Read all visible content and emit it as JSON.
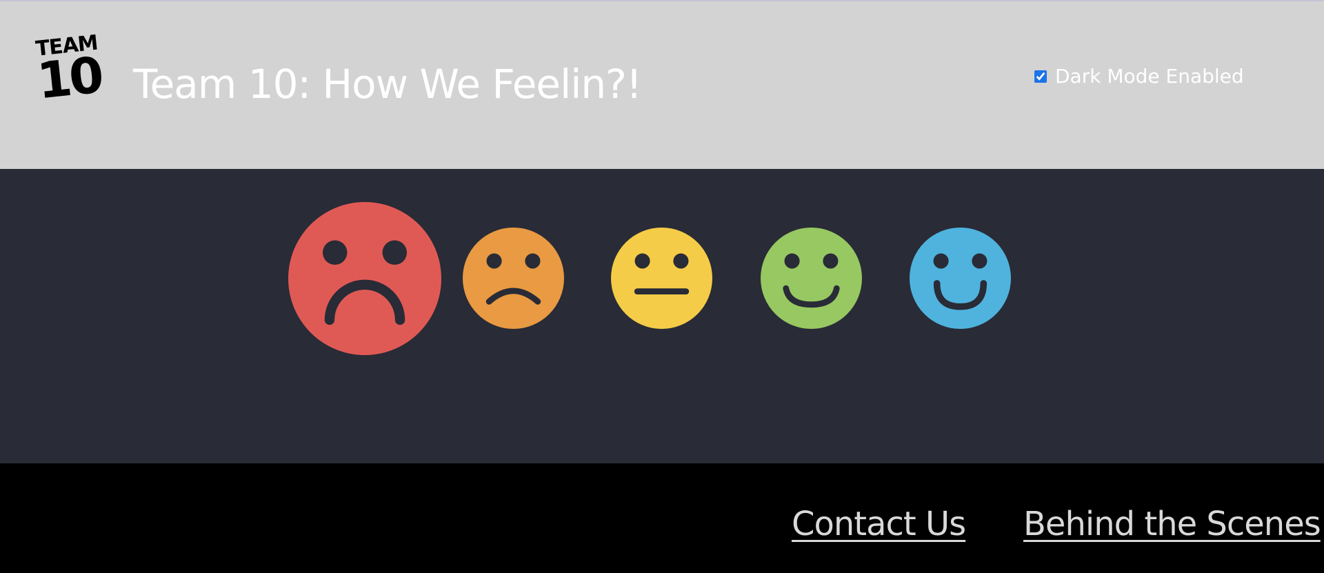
{
  "header": {
    "logo": {
      "line1": "TEAM",
      "line2": "10"
    },
    "title": "Team 10: How We Feelin?!",
    "dark_mode": {
      "label": "Dark Mode Enabled",
      "checked": true
    }
  },
  "moods": [
    {
      "icon": "very-sad-face-icon",
      "color": "#e05a55",
      "selected": true
    },
    {
      "icon": "sad-face-icon",
      "color": "#e99a42"
    },
    {
      "icon": "neutral-face-icon",
      "color": "#f5cc48"
    },
    {
      "icon": "happy-face-icon",
      "color": "#97c862"
    },
    {
      "icon": "very-happy-face-icon",
      "color": "#4fb3de"
    }
  ],
  "colors": {
    "header_bg": "#d3d3d3",
    "main_bg": "#292b36",
    "footer_bg": "#000000",
    "face_features": "#292b36"
  },
  "footer": {
    "links": [
      {
        "label": "Contact Us"
      },
      {
        "label": "Behind the Scenes"
      }
    ]
  }
}
